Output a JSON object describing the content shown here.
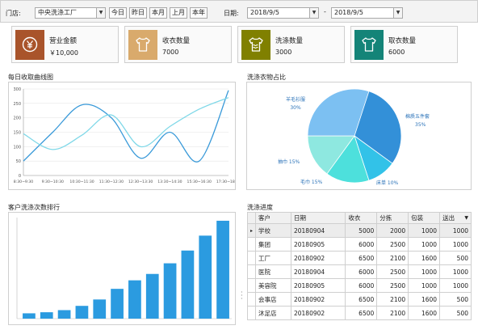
{
  "filter": {
    "store_label": "门店:",
    "store_value": "中央洗涤工厂",
    "buttons": [
      "今日",
      "昨日",
      "本月",
      "上月",
      "本年"
    ],
    "date_label": "日期:",
    "date_from": "2018/9/5",
    "date_to": "2018/9/5",
    "range_separator": "-"
  },
  "kpis": [
    {
      "title": "营业金额",
      "value": "￥10,000",
      "color": "#a9542b",
      "icon": "yen-icon"
    },
    {
      "title": "收衣数量",
      "value": "7000",
      "color": "#d9aa6c",
      "icon": "shirt-icon"
    },
    {
      "title": "洗涤数量",
      "value": "3000",
      "color": "#808000",
      "icon": "washing-shirt-icon"
    },
    {
      "title": "取衣数量",
      "value": "6000",
      "color": "#148478",
      "icon": "shirt-icon"
    }
  ],
  "panels": {
    "daily_curve_title": "每日收取曲线图",
    "pie_title": "洗涤衣物占比",
    "ranking_title": "客户洗涤次数排行",
    "progress_title": "洗涤进度"
  },
  "chart_data": [
    {
      "type": "line",
      "title": "每日收取曲线图",
      "x": [
        "8:30~9:30",
        "9:30~10:30",
        "10:30~11:30",
        "11:30~12:30",
        "12:30~13:30",
        "13:30~14:30",
        "15:30~16:30",
        "17:30~18:30"
      ],
      "ylim": [
        0,
        300
      ],
      "yticks": [
        "0",
        "50",
        "100",
        "150",
        "200",
        "250",
        "300"
      ],
      "series": [
        {
          "values": [
            50,
            150,
            245,
            200,
            60,
            150,
            50,
            295
          ],
          "color": "#3a9ad9"
        },
        {
          "values": [
            145,
            90,
            140,
            210,
            100,
            170,
            230,
            270
          ],
          "color": "#7fd8e8"
        }
      ],
      "grid": true
    },
    {
      "type": "pie",
      "title": "洗涤衣物占比",
      "slices": [
        {
          "label": "棉质五件套",
          "percent": 35,
          "color": "#3390d8"
        },
        {
          "label": "床单",
          "percent": 10,
          "color": "#32c2e8"
        },
        {
          "label": "毛巾",
          "percent": 15,
          "color": "#4de0dc"
        },
        {
          "label": "抽巾",
          "percent": 15,
          "color": "#8ee8e0"
        },
        {
          "label": "羊毛衫服",
          "percent": 30,
          "color": "#7cc0f2"
        }
      ],
      "label_texts": {
        "棉质五件套": "棉质五件套",
        "pct_35": "35%",
        "床单": "床单  10%",
        "毛巾": "毛巾  15%",
        "抽巾": "抽巾  15%",
        "羊毛衫服": "羊毛衫服",
        "pct_30": "30%"
      }
    },
    {
      "type": "bar",
      "title": "客户洗涤次数排行",
      "categories": [
        "",
        "",
        "",
        "",
        "",
        "",
        "",
        "",
        "",
        "",
        "",
        ""
      ],
      "values": [
        10,
        12,
        16,
        24,
        36,
        56,
        72,
        84,
        104,
        128,
        156,
        184
      ],
      "ylim": [
        0,
        190
      ],
      "color": "#2b9be0"
    }
  ],
  "table": {
    "columns": [
      "客户",
      "日期",
      "收衣",
      "分拣",
      "包装",
      "送出"
    ],
    "rows": [
      {
        "customer": "学校",
        "date": "20180904",
        "receive": "5000",
        "sort": "2000",
        "pack": "1000",
        "send": "1000"
      },
      {
        "customer": "集团",
        "date": "20180905",
        "receive": "6000",
        "sort": "2500",
        "pack": "1000",
        "send": "1000"
      },
      {
        "customer": "工厂",
        "date": "20180902",
        "receive": "6500",
        "sort": "2100",
        "pack": "1600",
        "send": "500"
      },
      {
        "customer": "医院",
        "date": "20180904",
        "receive": "6000",
        "sort": "2500",
        "pack": "1000",
        "send": "1000"
      },
      {
        "customer": "美容院",
        "date": "20180905",
        "receive": "6000",
        "sort": "2500",
        "pack": "1000",
        "send": "1000"
      },
      {
        "customer": "会事店",
        "date": "20180902",
        "receive": "6500",
        "sort": "2100",
        "pack": "1600",
        "send": "500"
      },
      {
        "customer": "沐足店",
        "date": "20180902",
        "receive": "6500",
        "sort": "2100",
        "pack": "1600",
        "send": "500"
      }
    ],
    "current_marker": "▸",
    "sort_indicator": "▼"
  }
}
